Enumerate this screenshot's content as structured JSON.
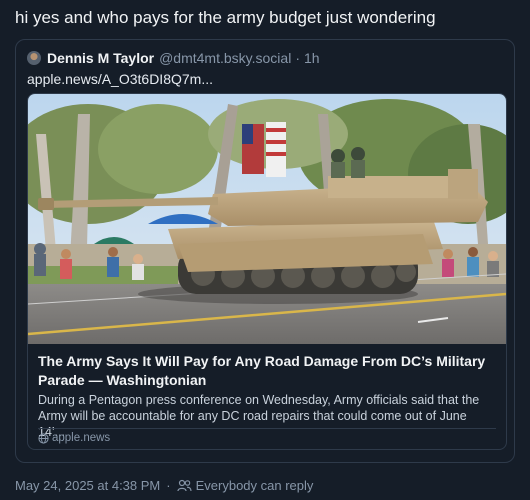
{
  "post": {
    "text": "hi yes and who pays for the army budget just wondering"
  },
  "quote": {
    "author_name": "Dennis M Taylor",
    "author_handle": "@dmt4mt.bsky.social",
    "separator": "·",
    "time": "1h",
    "link_text": "apple.news/A_O3t6DI8Q7m...",
    "card": {
      "title": "The Army Says It Will Pay for Any Road Damage From DC’s Military Parade — Washingtonian",
      "description": "During a Pentagon press conference on Wednesday, Army officials said that the Army will be accountable for any DC road repairs that could come out of June 14’...",
      "domain": "apple.news",
      "image_icon": "photo-of-tank-in-parade"
    }
  },
  "meta": {
    "timestamp": "May 24, 2025 at 4:38 PM",
    "separator": "·",
    "reply_setting": "Everybody can reply",
    "reply_icon": "people-icon"
  },
  "colors": {
    "background": "#151d28",
    "border": "#2e3a4a",
    "text": "#f1f3f5",
    "muted": "#8796a8"
  }
}
